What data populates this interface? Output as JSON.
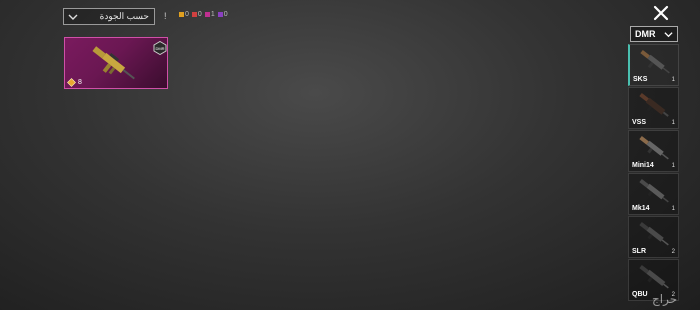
{
  "sort": {
    "label": "حسب الجودة"
  },
  "info_mark": "!",
  "counters": [
    {
      "color": "#e0a020",
      "value": "0"
    },
    {
      "color": "#d04040",
      "value": "0"
    },
    {
      "color": "#c03090",
      "value": "1"
    },
    {
      "color": "#8a40c0",
      "value": "0"
    }
  ],
  "weapon_card": {
    "tier_value": "8",
    "badge": "DMR"
  },
  "category": {
    "label": "DMR"
  },
  "weapons": [
    {
      "name": "SKS",
      "count": "1",
      "icon": "dmr-rifle-icon"
    },
    {
      "name": "VSS",
      "count": "1",
      "icon": "dmr-rifle-icon"
    },
    {
      "name": "Mini14",
      "count": "1",
      "icon": "dmr-rifle-icon"
    },
    {
      "name": "Mk14",
      "count": "1",
      "icon": "dmr-rifle-icon"
    },
    {
      "name": "SLR",
      "count": "2",
      "icon": "dmr-rifle-icon"
    },
    {
      "name": "QBU",
      "count": "2",
      "icon": "dmr-rifle-icon"
    }
  ],
  "watermark": "حراج"
}
